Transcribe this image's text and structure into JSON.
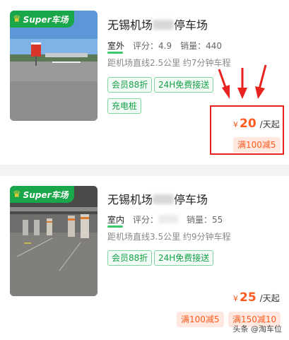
{
  "brand_badge": {
    "crown_icon": "crown-icon",
    "label": "Super车场"
  },
  "listings": [
    {
      "title_start": "无锡机场",
      "title_end": "停车场",
      "location_type": "室外",
      "rating_label": "评分：",
      "rating": "4.9",
      "sales_label": "销量：",
      "sales": "440",
      "distance": "距机场直线2.5公里 约7分钟车程",
      "tags": [
        "会员88折",
        "24H免费接送",
        "充电桩"
      ],
      "currency": "¥",
      "price": "20",
      "unit": "/天起",
      "promos": [
        "满100减5"
      ]
    },
    {
      "title_start": "无锡机场",
      "title_end": "停车场",
      "location_type": "室内",
      "rating_label": "评分：",
      "rating": "",
      "sales_label": "销量：",
      "sales": "55",
      "distance": "距机场直线3.5公里 约9分钟车程",
      "tags": [
        "会员88折",
        "24H免费接送"
      ],
      "currency": "¥",
      "price": "25",
      "unit": "/天起",
      "promos": [
        "满100减5",
        "满150减10"
      ]
    }
  ],
  "annotation_color": "#e8231f",
  "accent_green": "#1aa64a",
  "price_color": "#ff5a1f",
  "watermark": "头条 @淘车位"
}
